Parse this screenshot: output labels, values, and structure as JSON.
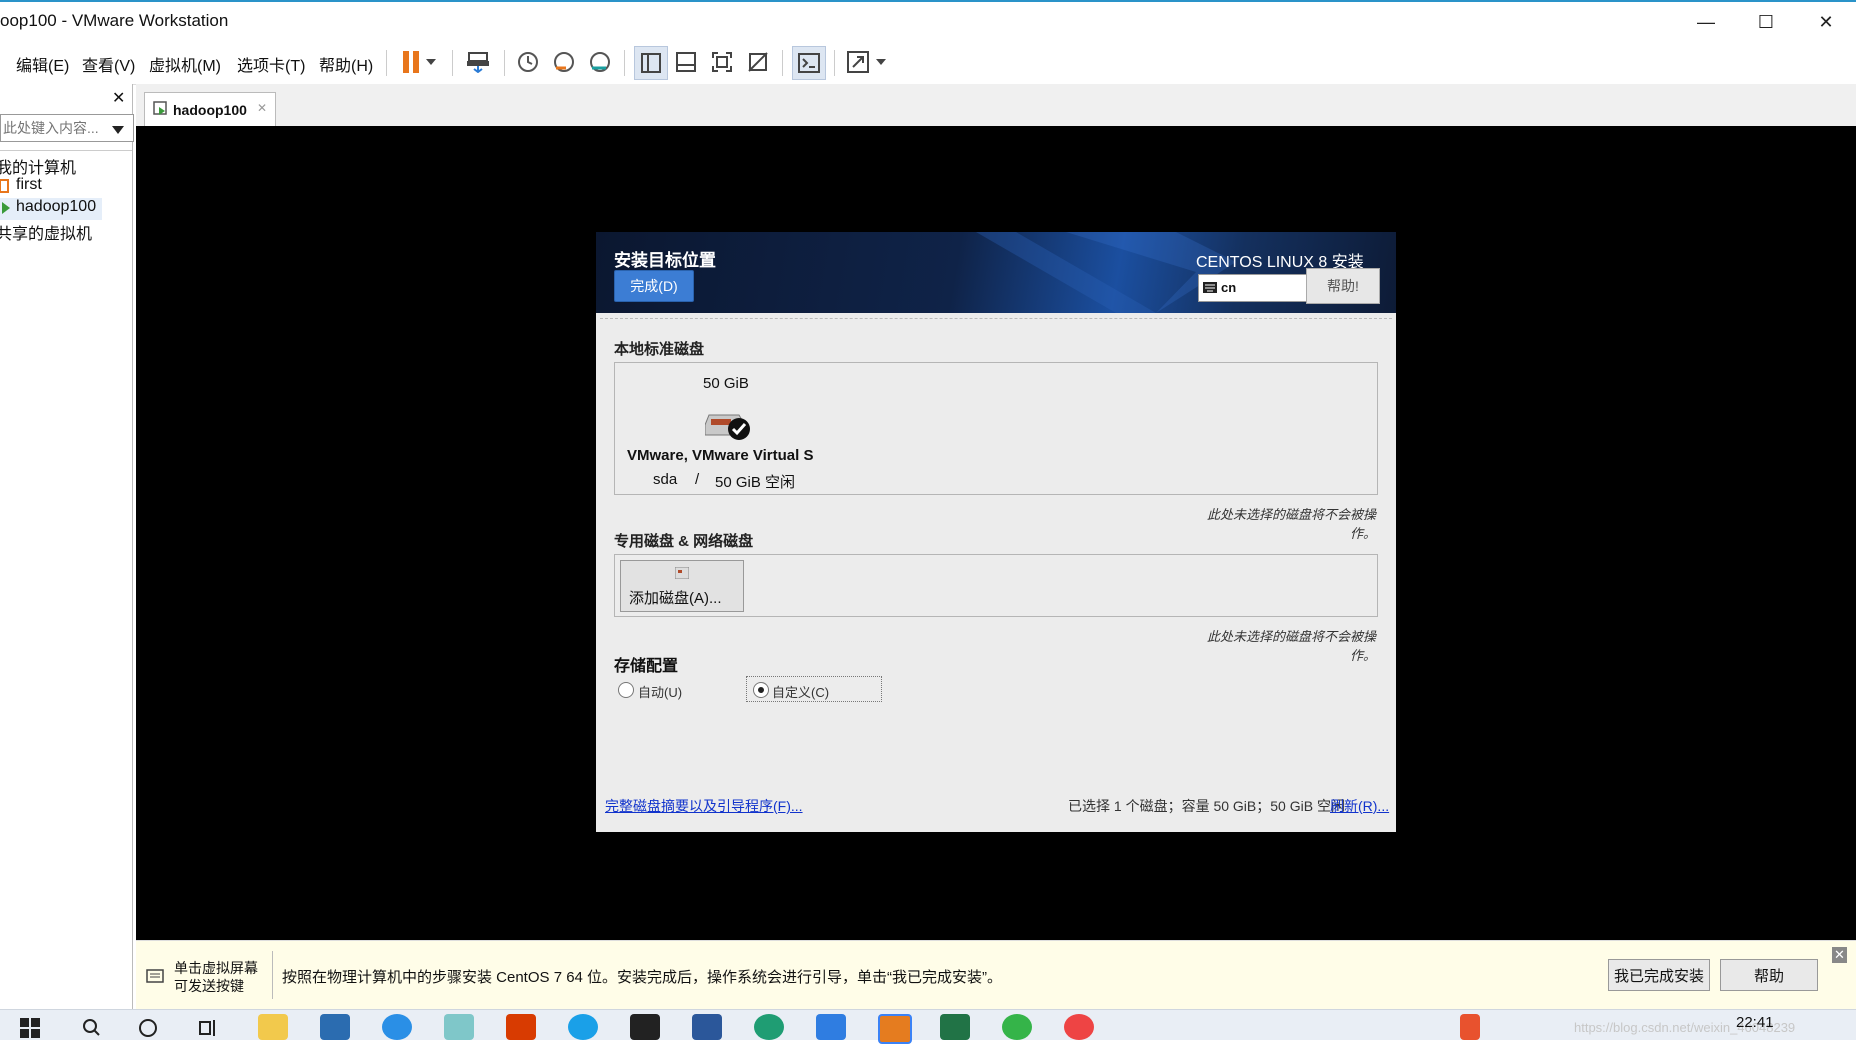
{
  "window": {
    "title": "oop100 - VMware Workstation",
    "minimize": "—",
    "maximize": "☐",
    "close": "✕"
  },
  "menu": {
    "items": [
      {
        "label": "编辑(E)"
      },
      {
        "label": "查看(V)"
      },
      {
        "label": "虚拟机(M)"
      },
      {
        "label": "选项卡(T)"
      },
      {
        "label": "帮助(H)"
      }
    ]
  },
  "sidebar": {
    "close": "✕",
    "search_placeholder": "此处键入内容...",
    "tree": {
      "root": "我的计算机",
      "vm1": "first",
      "vm2": "hadoop100",
      "shared": "共享的虚拟机"
    }
  },
  "tab": {
    "label": "hadoop100",
    "close": "✕"
  },
  "installer": {
    "page_title": "安装目标位置",
    "done_button": "完成(D)",
    "product": "CENTOS LINUX 8 安装",
    "keyboard": "cn",
    "help_button": "帮助!",
    "local_disks_label": "本地标准磁盘",
    "disk": {
      "size": "50 GiB",
      "name": "VMware, VMware Virtual S",
      "device": "sda",
      "sep": "/",
      "free": "50 GiB 空闲"
    },
    "note1": "此处未选择的磁盘将不会被操作。",
    "special_disks_label": "专用磁盘 & 网络磁盘",
    "add_disk_button": "添加磁盘(A)...",
    "note2": "此处未选择的磁盘将不会被操作。",
    "storage_label": "存储配置",
    "radio_auto": "自动(U)",
    "radio_custom": "自定义(C)",
    "summary_link": "完整磁盘摘要以及引导程序(F)...",
    "status": "已选择 1 个磁盘；容量 50 GiB；50 GiB 空闲",
    "refresh_link": "刷新(R)..."
  },
  "hint": {
    "click_label": "单击虚拟屏幕\n可发送按键",
    "message": "按照在物理计算机中的步骤安装 CentOS 7 64 位。安装完成后，操作系统会进行引导，单击“我已完成安装”。",
    "finish_button": "我已完成安装",
    "help_button": "帮助",
    "close": "✕"
  },
  "taskbar": {
    "clock": "22:41",
    "watermark": "https://blog.csdn.net/weixin_46048239"
  },
  "colors": {
    "accent_blue": "#3c7dd4",
    "vm_background": "#000000",
    "hint_background": "#fffde8",
    "link_blue": "#1133cc"
  }
}
